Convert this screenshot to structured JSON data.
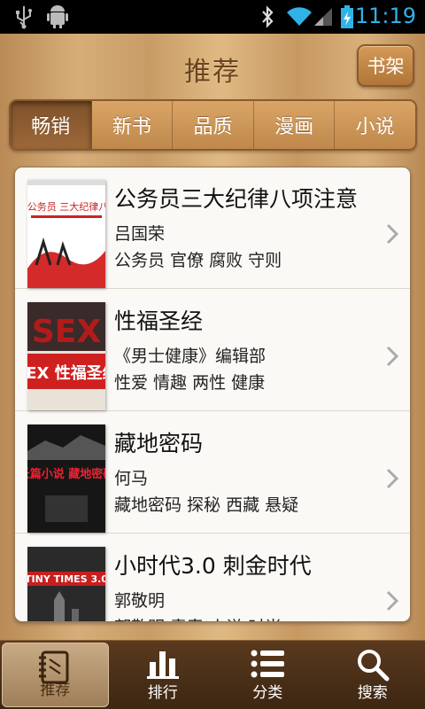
{
  "status_bar": {
    "time": "11:19",
    "icons": [
      "usb-icon",
      "android-debug-icon",
      "bluetooth-icon",
      "wifi-icon",
      "signal-icon",
      "battery-charging-icon"
    ]
  },
  "header": {
    "title": "推荐",
    "shelf_button": "书架"
  },
  "tabs": [
    {
      "label": "畅销",
      "active": true
    },
    {
      "label": "新书"
    },
    {
      "label": "品质"
    },
    {
      "label": "漫画"
    },
    {
      "label": "小说"
    }
  ],
  "books": [
    {
      "title": "公务员三大纪律八项注意",
      "author": "吕国荣",
      "tags": "公务员 官僚 腐败 守则",
      "cover_text": "公务员 三大纪律八项注意"
    },
    {
      "title": "性福圣经",
      "author": "《男士健康》编辑部",
      "tags": "性爱 情趣 两性 健康",
      "cover_text": "SEX 性福圣经"
    },
    {
      "title": "藏地密码",
      "author": "何马",
      "tags": "藏地密码 探秘 西藏 悬疑",
      "cover_text": "长篇小说 藏地密码"
    },
    {
      "title": "小时代3.0 刺金时代",
      "author": "郭敬明",
      "tags": "郭敬明 青春 小说 时尚",
      "cover_text": "TINY TIMES 3.0"
    }
  ],
  "bottom_nav": [
    {
      "label": "推荐",
      "icon": "notebook-icon",
      "active": true
    },
    {
      "label": "排行",
      "icon": "bar-chart-icon"
    },
    {
      "label": "分类",
      "icon": "list-icon"
    },
    {
      "label": "搜索",
      "icon": "search-icon"
    }
  ],
  "colors": {
    "status_bg": "#000000",
    "status_fg": "#2fb2e6",
    "title": "#6a4420",
    "nav_bg": "#4a2e16"
  }
}
